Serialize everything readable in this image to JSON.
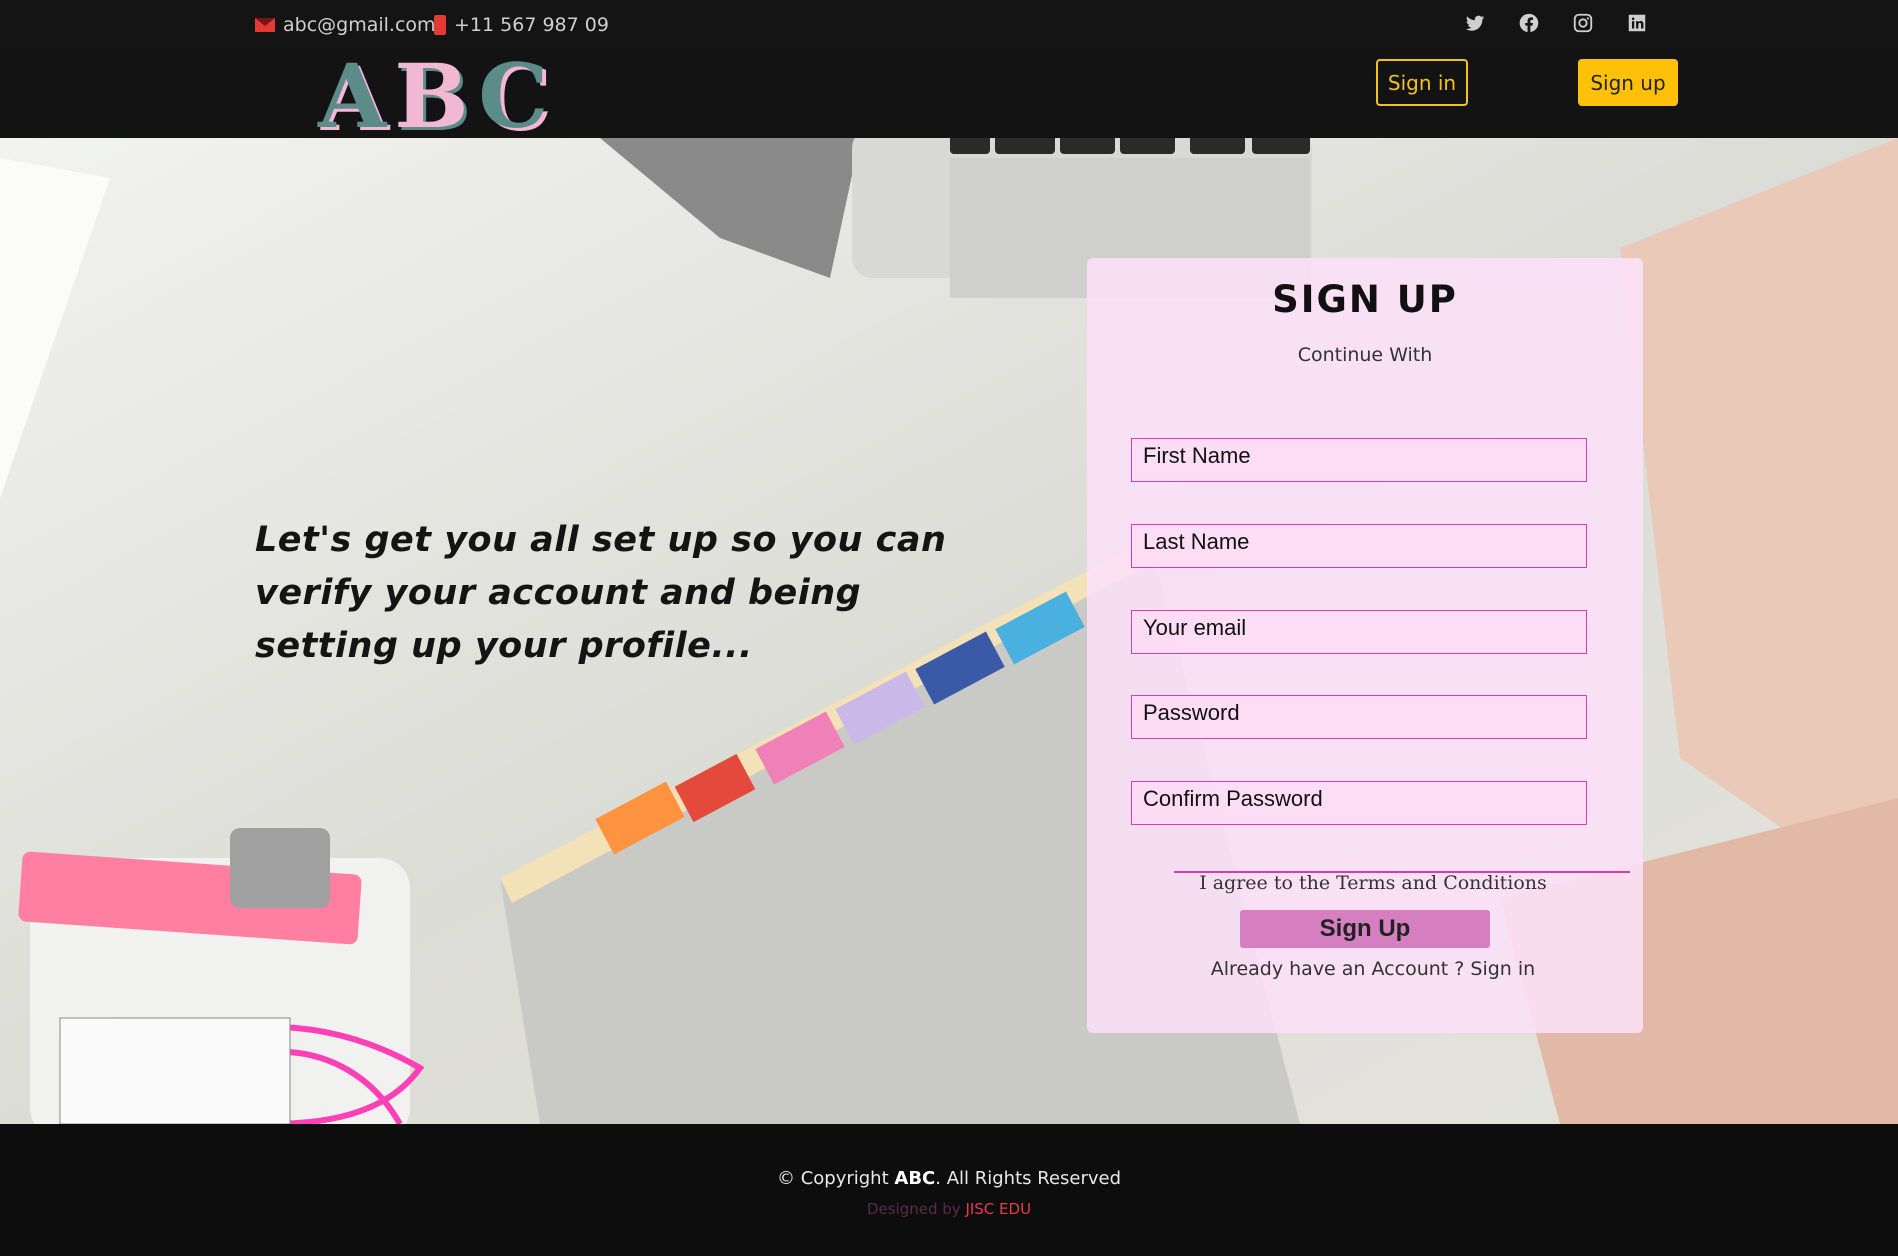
{
  "topbar": {
    "email": "abc@gmail.com",
    "phone": "+11 567 987 09",
    "social_icons": [
      "twitter-icon",
      "facebook-icon",
      "instagram-icon",
      "linkedin-icon"
    ]
  },
  "navbar": {
    "logo": {
      "l1": "A",
      "l2": "B",
      "l3": "C"
    },
    "signin_label": "Sign in",
    "signup_label": "Sign up"
  },
  "hero": {
    "tagline": "Let's get you all set up so you can verify your account and being setting up your profile..."
  },
  "form": {
    "title": "SIGN UP",
    "subtitle": "Continue With",
    "fields": {
      "first_name": "First Name",
      "last_name": "Last Name",
      "email": "Your email",
      "password": "Password",
      "confirm_password": "Confirm Password"
    },
    "agree_text": "I agree to the Terms and Conditions",
    "submit_label": "Sign Up",
    "account_text": "Already have an Account ? Sign in"
  },
  "footer": {
    "copyright_prefix": "© Copyright",
    "brand": "ABC",
    "copyright_suffix": ". All Rights Reserved",
    "designed_by": "Designed by",
    "designer": "JISC EDU"
  },
  "colors": {
    "accent": "#ffc107",
    "form_border": "#d63fa6",
    "submit_bg": "#d67fc0",
    "card_bg": "#fce0f8"
  }
}
